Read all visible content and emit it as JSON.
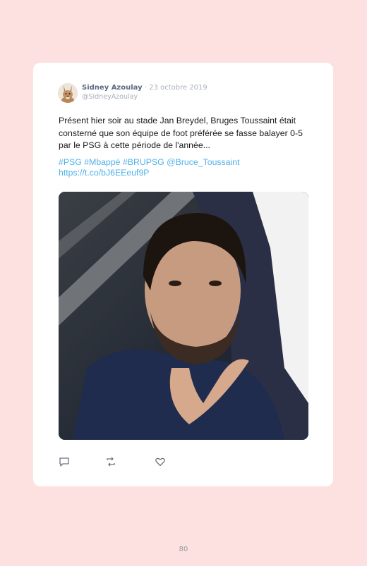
{
  "tweet": {
    "author_name": "Sidney Azoulay",
    "separator": "·",
    "date": "23 octobre 2019",
    "handle": "@SidneyAzoulay",
    "text": "Présent hier soir au stade Jan Breydel, Bruges Toussaint était consterné que son équipe de foot préférée se fasse balayer 0-5 par le PSG à cette période de l'année...",
    "hashtags": [
      "#PSG",
      "#Mbappé",
      "#BRUPSG",
      "@Bruce_Toussaint"
    ],
    "link": "https://t.co/bJ6EEeuf9P",
    "photo_icon": "photo-of-man-in-stadium",
    "avatar_icon": "rabbit-avatar-icon"
  },
  "actions": {
    "reply_icon": "reply-icon",
    "retweet_icon": "retweet-icon",
    "like_icon": "heart-icon"
  },
  "footer": {
    "page_number": "80"
  },
  "colors": {
    "background": "#fde0e0",
    "card": "#ffffff",
    "link": "#4fb1ea",
    "name": "#5b6b83"
  }
}
